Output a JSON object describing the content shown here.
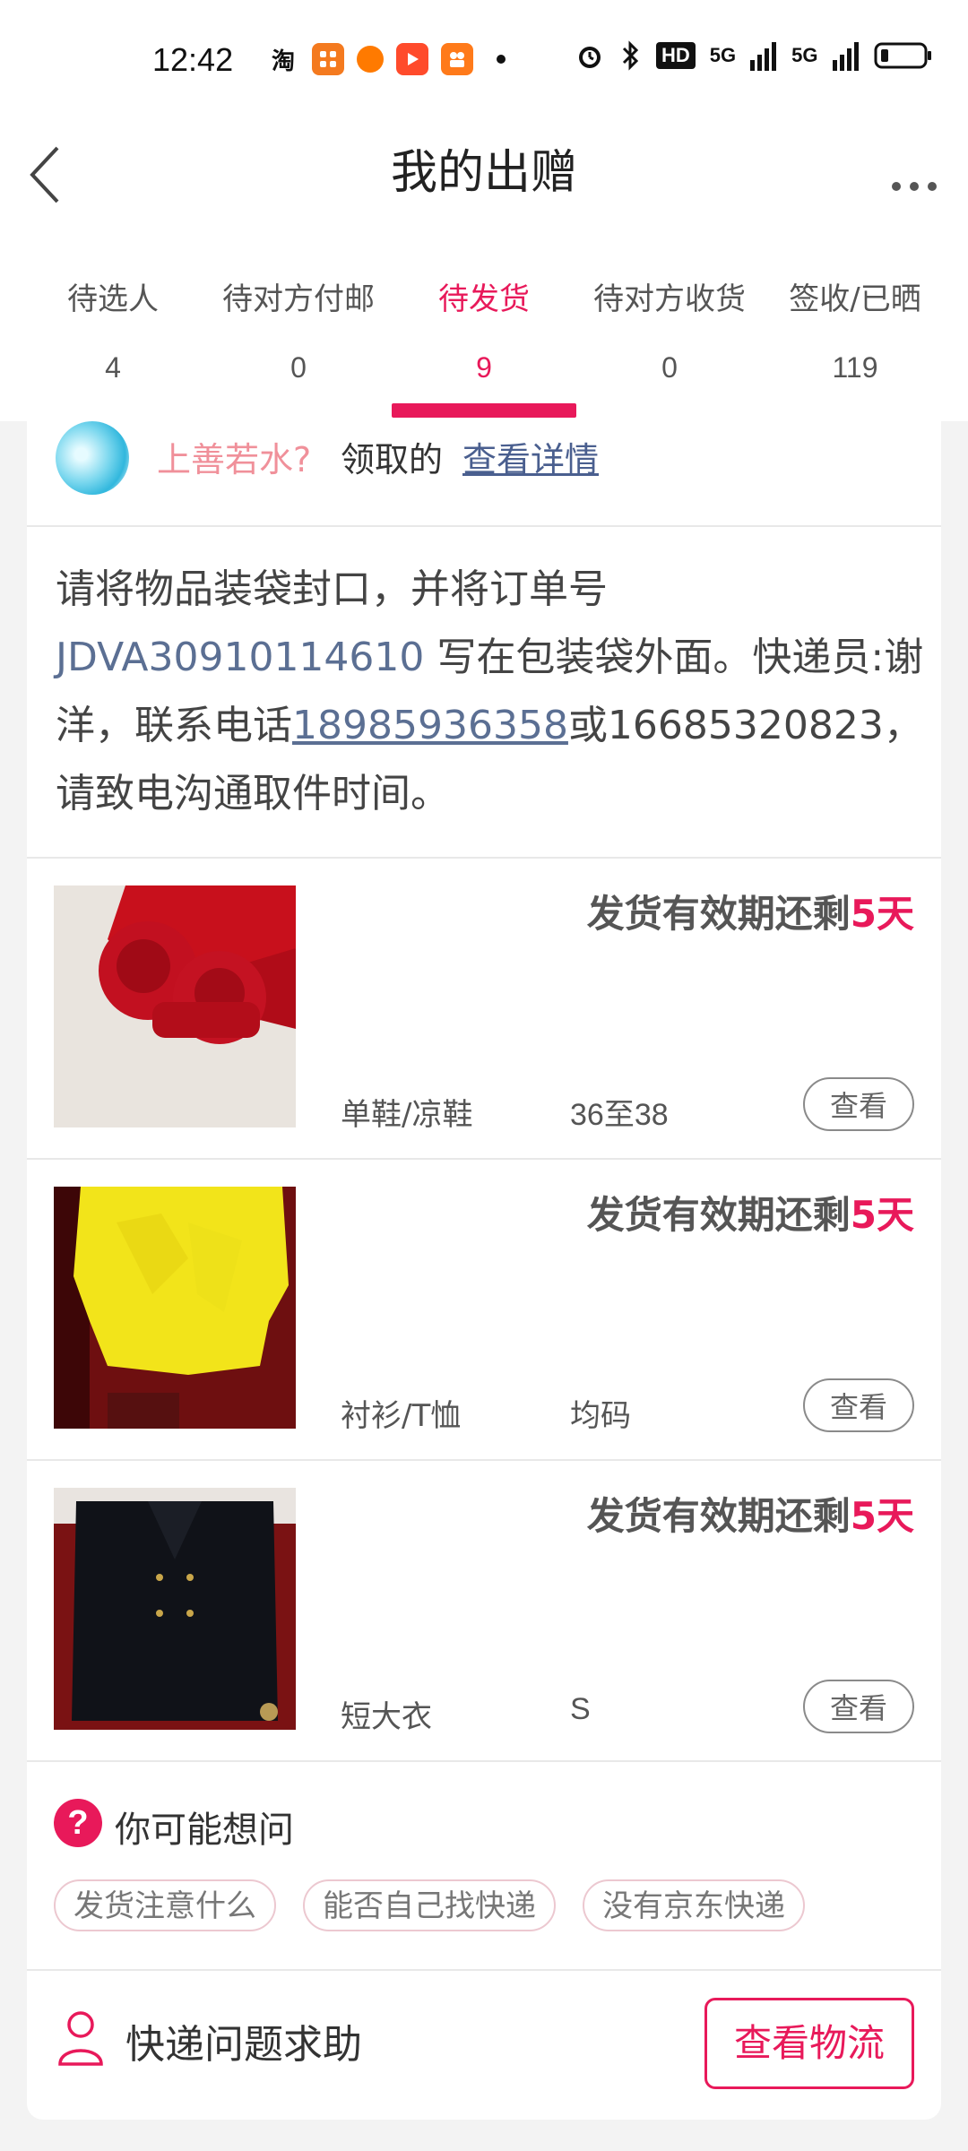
{
  "status_bar": {
    "time": "12:42",
    "app_icons": [
      "taobao-icon",
      "app-icon",
      "weibo-icon",
      "video-icon",
      "kuaishou-icon"
    ],
    "hd_label": "HD",
    "signal_label_1": "5G",
    "signal_label_2": "5G"
  },
  "header": {
    "title": "我的出赠"
  },
  "tabs": [
    {
      "label": "待选人",
      "count": "4"
    },
    {
      "label": "待对方付邮",
      "count": "0"
    },
    {
      "label": "待发货",
      "count": "9"
    },
    {
      "label": "待对方收货",
      "count": "0"
    },
    {
      "label": "签收/已晒",
      "count": "119"
    }
  ],
  "receiver": {
    "name": "上善若水?",
    "action": "领取的",
    "link": "查看详情"
  },
  "instruction": {
    "part1": "请将物品装袋封口，并将订单号 ",
    "order_no": "JDVA30910114610",
    "part2": " 写在包装袋外面。快递员:谢洋，联系电话",
    "phone1": "18985936358",
    "part3": "或16685320823，请致电沟通取件时间。"
  },
  "items": [
    {
      "deadline_prefix": "发货有效期还剩",
      "deadline_days": "5天",
      "category": "单鞋/凉鞋",
      "size": "36至38",
      "view_label": "查看"
    },
    {
      "deadline_prefix": "发货有效期还剩",
      "deadline_days": "5天",
      "category": "衬衫/T恤",
      "size": "均码",
      "view_label": "查看"
    },
    {
      "deadline_prefix": "发货有效期还剩",
      "deadline_days": "5天",
      "category": "短大衣",
      "size": "S",
      "view_label": "查看"
    }
  ],
  "faq": {
    "icon": "?",
    "title": "你可能想问",
    "chips": [
      "发货注意什么",
      "能否自己找快递",
      "没有京东快递"
    ]
  },
  "help": {
    "label": "快递问题求助",
    "button": "查看物流"
  },
  "colors": {
    "accent": "#e8195a",
    "link": "#5b6f93",
    "receiver_name": "#f0909a"
  }
}
